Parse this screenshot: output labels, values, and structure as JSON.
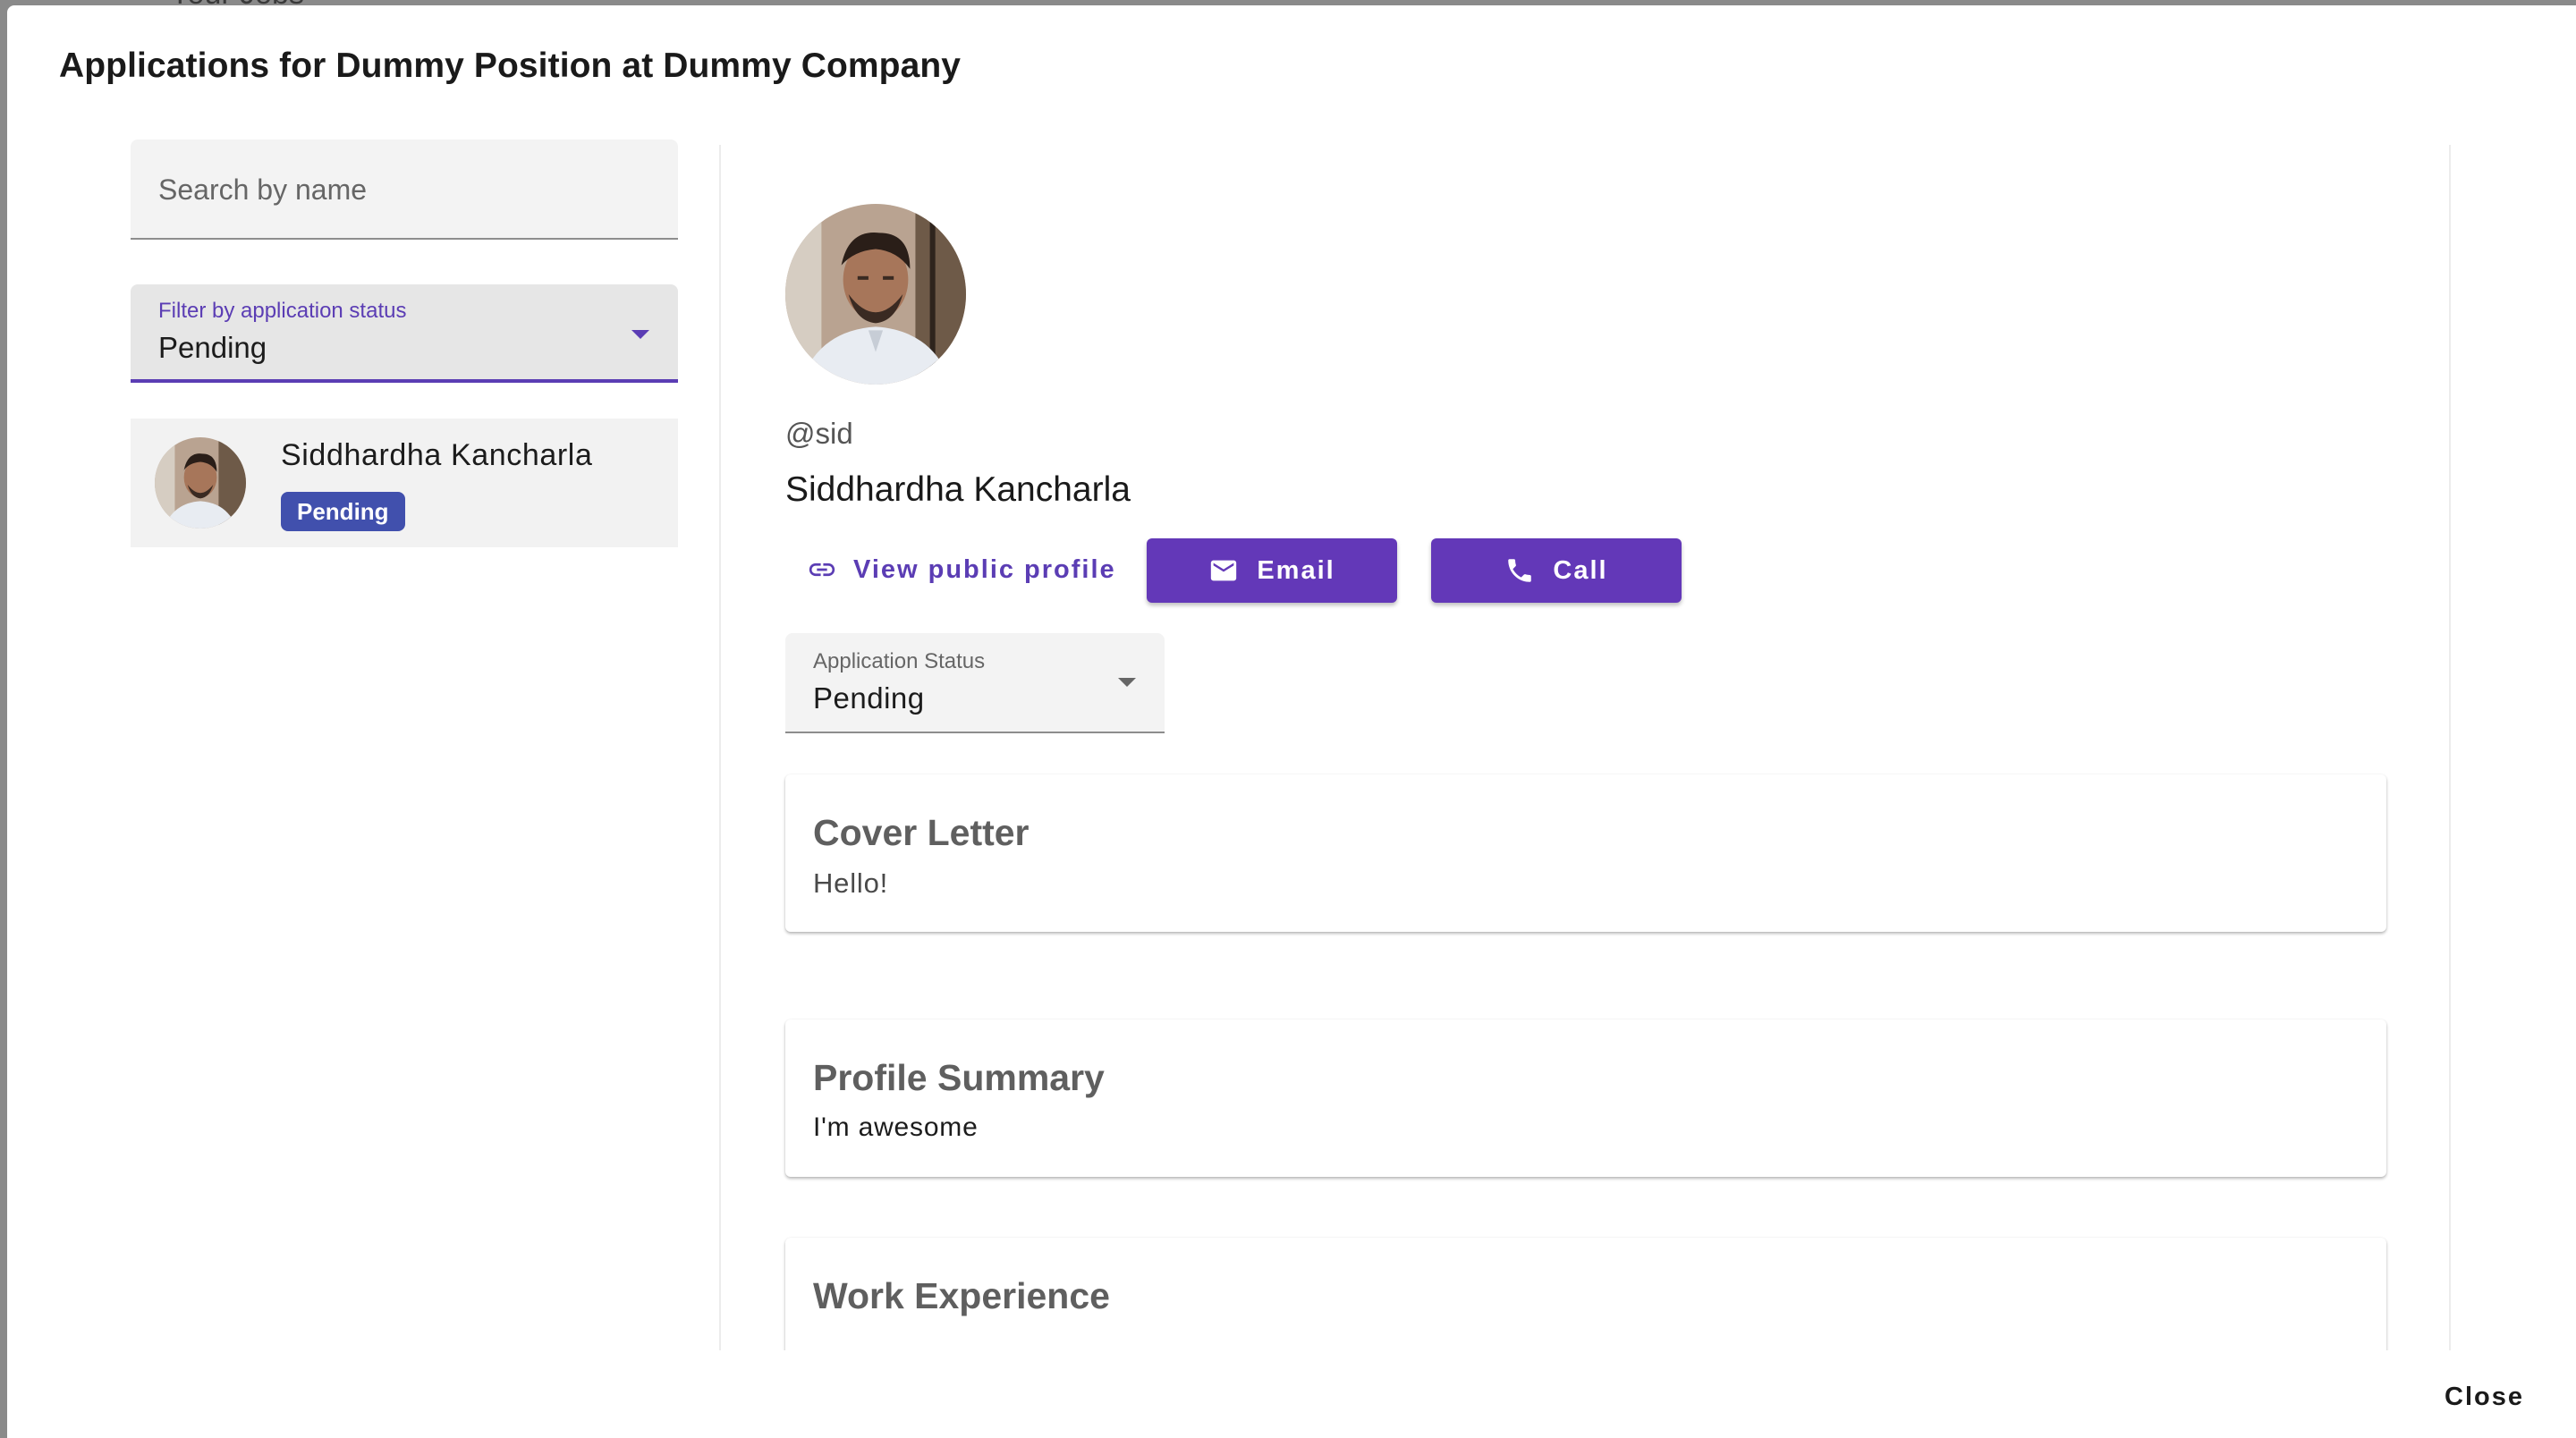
{
  "backdrop": {
    "peek_text": "Your Jobs"
  },
  "dialog": {
    "title": "Applications for Dummy Position at Dummy Company",
    "close_label": "Close"
  },
  "sidebar": {
    "search": {
      "placeholder": "Search by name",
      "value": ""
    },
    "filter": {
      "label": "Filter by application status",
      "value": "Pending"
    },
    "applicants": [
      {
        "name": "Siddhardha Kancharla",
        "status": "Pending"
      }
    ]
  },
  "detail": {
    "handle": "@sid",
    "name": "Siddhardha Kancharla",
    "actions": {
      "public_profile_label": "View public profile",
      "email_label": "Email",
      "call_label": "Call"
    },
    "status_select": {
      "label": "Application Status",
      "value": "Pending"
    },
    "sections": {
      "cover_letter": {
        "title": "Cover Letter",
        "body": "Hello!"
      },
      "profile_summary": {
        "title": "Profile Summary",
        "body": "I'm awesome"
      },
      "work_experience": {
        "title": "Work Experience"
      }
    }
  },
  "colors": {
    "accent": "#5b3db4",
    "button": "#6338b8",
    "status_badge": "#4150ad"
  },
  "icons": [
    "link-icon",
    "mail-icon",
    "phone-icon",
    "chevron-down-icon"
  ]
}
